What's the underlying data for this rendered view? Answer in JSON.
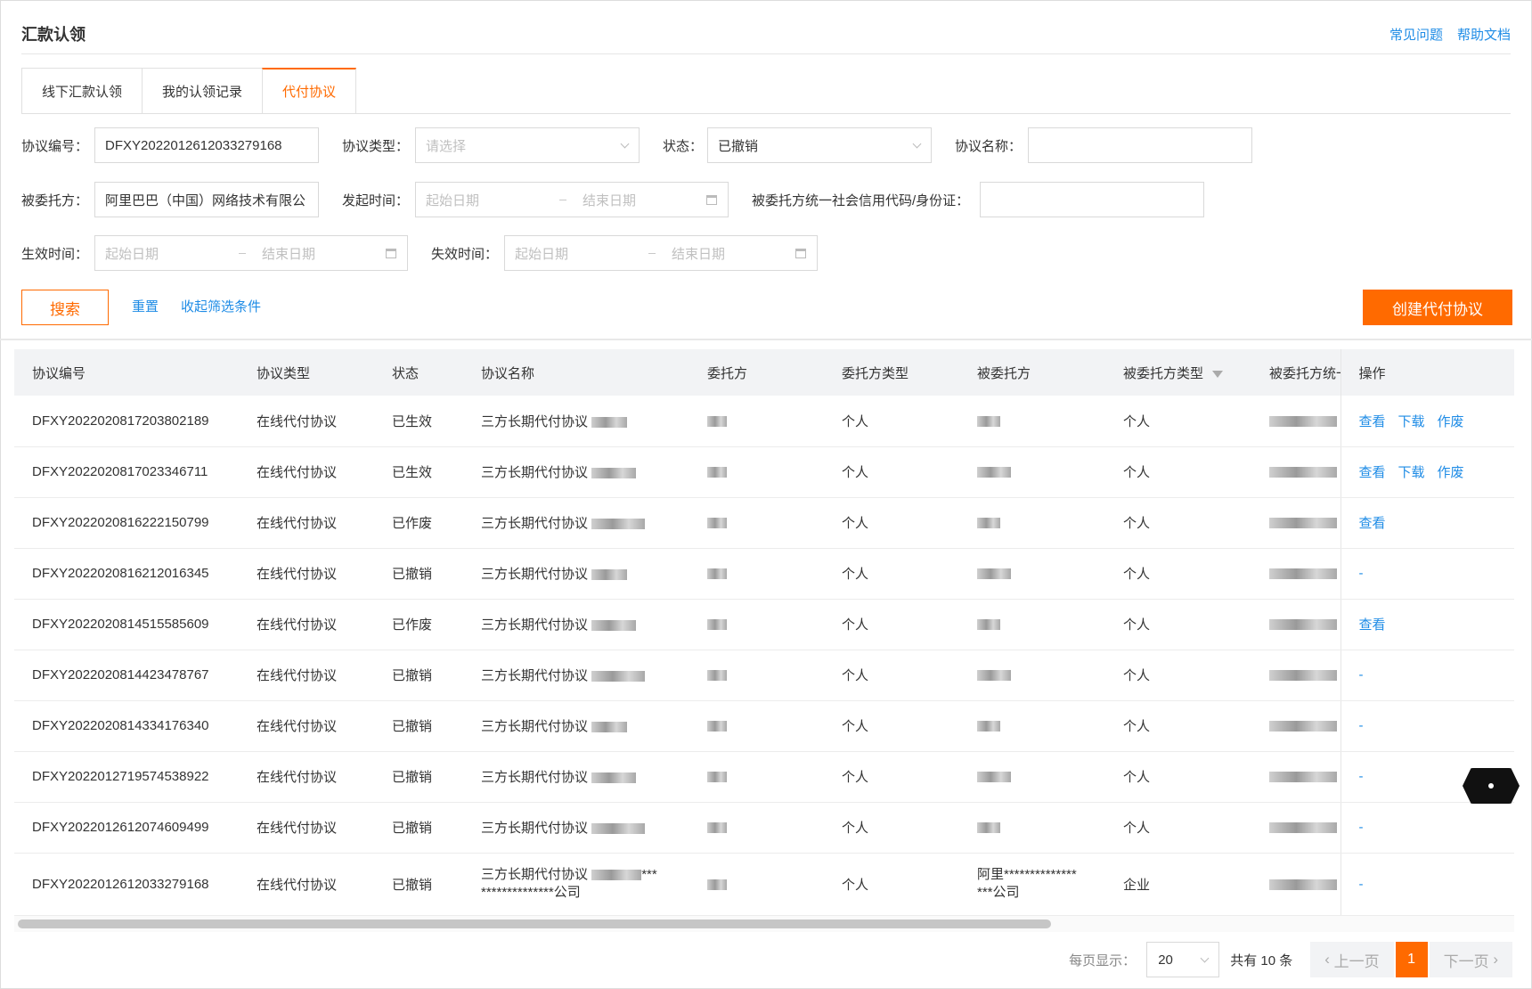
{
  "header": {
    "title": "汇款认领",
    "links": [
      "常见问题",
      "帮助文档"
    ]
  },
  "tabs": [
    {
      "label": "线下汇款认领",
      "active": false
    },
    {
      "label": "我的认领记录",
      "active": false
    },
    {
      "label": "代付协议",
      "active": true
    }
  ],
  "filters": {
    "agreement_no_label": "协议编号：",
    "agreement_no_value": "DFXY2022012612033279168",
    "agreement_type_label": "协议类型：",
    "agreement_type_placeholder": "请选择",
    "status_label": "状态：",
    "status_value": "已撤销",
    "agreement_name_label": "协议名称：",
    "trustee_label": "被委托方：",
    "trustee_value": "阿里巴巴（中国）网络技术有限公",
    "initiate_time_label": "发起时间：",
    "credit_code_label": "被委托方统一社会信用代码/身份证：",
    "effective_time_label": "生效时间：",
    "expire_time_label": "失效时间：",
    "start_date": "起始日期",
    "end_date": "结束日期"
  },
  "actions": {
    "search": "搜索",
    "reset": "重置",
    "collapse": "收起筛选条件",
    "create": "创建代付协议"
  },
  "table": {
    "columns": [
      "协议编号",
      "协议类型",
      "状态",
      "协议名称",
      "委托方",
      "委托方类型",
      "被委托方",
      "被委托方类型",
      "被委托方统一社",
      "操作"
    ],
    "rows": [
      {
        "no": "DFXY2022020817203802189",
        "type": "在线代付协议",
        "status": "已生效",
        "name": "三方长期代付协议",
        "principal_type": "个人",
        "trustee_type": "个人",
        "ops": [
          "查看",
          "下载",
          "作废"
        ]
      },
      {
        "no": "DFXY2022020817023346711",
        "type": "在线代付协议",
        "status": "已生效",
        "name": "三方长期代付协议",
        "principal_type": "个人",
        "trustee_type": "个人",
        "ops": [
          "查看",
          "下载",
          "作废"
        ]
      },
      {
        "no": "DFXY2022020816222150799",
        "type": "在线代付协议",
        "status": "已作废",
        "name": "三方长期代付协议",
        "principal_type": "个人",
        "trustee_type": "个人",
        "ops": [
          "查看"
        ]
      },
      {
        "no": "DFXY2022020816212016345",
        "type": "在线代付协议",
        "status": "已撤销",
        "name": "三方长期代付协议",
        "principal_type": "个人",
        "trustee_type": "个人",
        "ops": [
          "-"
        ]
      },
      {
        "no": "DFXY2022020814515585609",
        "type": "在线代付协议",
        "status": "已作废",
        "name": "三方长期代付协议",
        "principal_type": "个人",
        "trustee_type": "个人",
        "ops": [
          "查看"
        ]
      },
      {
        "no": "DFXY2022020814423478767",
        "type": "在线代付协议",
        "status": "已撤销",
        "name": "三方长期代付协议",
        "principal_type": "个人",
        "trustee_type": "个人",
        "ops": [
          "-"
        ]
      },
      {
        "no": "DFXY2022020814334176340",
        "type": "在线代付协议",
        "status": "已撤销",
        "name": "三方长期代付协议",
        "principal_type": "个人",
        "trustee_type": "个人",
        "ops": [
          "-"
        ]
      },
      {
        "no": "DFXY2022012719574538922",
        "type": "在线代付协议",
        "status": "已撤销",
        "name": "三方长期代付协议",
        "principal_type": "个人",
        "trustee_type": "个人",
        "ops": [
          "-"
        ]
      },
      {
        "no": "DFXY2022012612074609499",
        "type": "在线代付协议",
        "status": "已撤销",
        "name": "三方长期代付协议",
        "principal_type": "个人",
        "trustee_type": "个人",
        "ops": [
          "-"
        ]
      },
      {
        "no": "DFXY2022012612033279168",
        "type": "在线代付协议",
        "status": "已撤销",
        "name": "三方长期代付协议",
        "name_line2": "**************公司",
        "name_suffix": "***",
        "principal_type": "个人",
        "trustee": "阿里**************",
        "trustee_line2": "***公司",
        "trustee_type": "企业",
        "ops": [
          "-"
        ]
      }
    ]
  },
  "pagination": {
    "per_page_label": "每页显示：",
    "per_page": "20",
    "total": "共有 10 条",
    "prev": "上一页",
    "current": "1",
    "next": "下一页"
  }
}
